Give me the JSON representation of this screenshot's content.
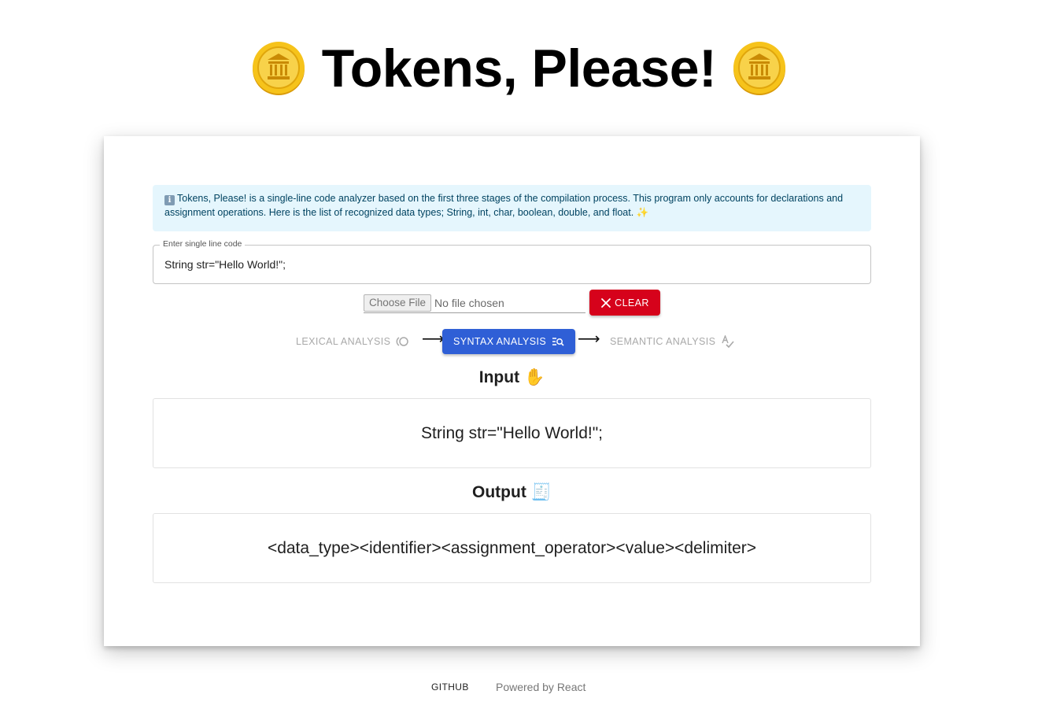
{
  "header": {
    "title": "Tokens, Please!",
    "left_icon": "coin-icon",
    "right_icon": "coin-icon"
  },
  "info_alert": {
    "icon": "info-icon",
    "icon_glyph": "i",
    "text": "Tokens, Please! is a single-line code analyzer based on the first three stages of the compilation process. This program only accounts for declarations and assignment operations. Here is the list of recognized data types; String, int, char, boolean, double, and float. ✨"
  },
  "code_field": {
    "label": "Enter single line code",
    "value": "String str=\"Hello World!\";"
  },
  "file_picker": {
    "button_label": "Choose File",
    "status": "No file chosen"
  },
  "clear_button": {
    "label": "CLEAR",
    "icon": "close-icon",
    "color": "#d6021b"
  },
  "stages": {
    "lexical": {
      "label": "LEXICAL ANALYSIS",
      "icon": "lexical-icon",
      "state": "disabled"
    },
    "syntax": {
      "label": "SYNTAX ANALYSIS",
      "icon": "search-list-icon",
      "state": "active"
    },
    "semantic": {
      "label": "SEMANTIC ANALYSIS",
      "icon": "spellcheck-icon",
      "state": "disabled"
    },
    "arrow_glyph": "⟶",
    "active_color": "#2f5fd6"
  },
  "input_section": {
    "heading": "Input",
    "emoji": "✋",
    "content": "String str=\"Hello World!\";"
  },
  "output_section": {
    "heading": "Output",
    "emoji": "🧾",
    "content": "<data_type><identifier><assignment_operator><value><delimiter>"
  },
  "footer": {
    "github_label": "GITHUB",
    "powered_by": "Powered by React"
  }
}
